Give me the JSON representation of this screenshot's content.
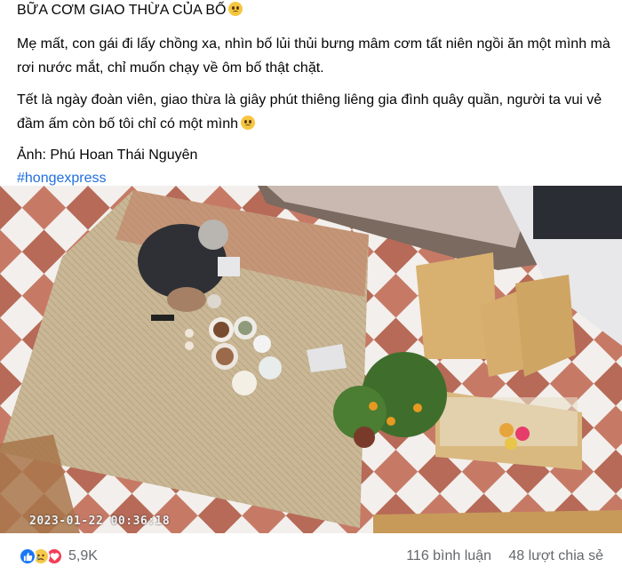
{
  "post": {
    "title": "BỮA CƠM GIAO THỪA CỦA BỐ",
    "paragraph_1": "Mẹ mất, con gái đi lấy chồng xa, nhìn bố lủi thủi bưng mâm cơm tất niên ngồi ăn một mình mà rơi nước mắt, chỉ muốn chạy về ôm bố thật chặt.",
    "paragraph_2": "Tết là ngày đoàn viên, giao thừa là giây phút thiêng liêng gia đình quây quần, người ta vui vẻ đầm ấm còn bố tôi chỉ có một mình",
    "credit": "Ảnh: Phú Hoan Thái Nguyên",
    "hashtag": "#hongexpress",
    "title_emoji": "pleading-face-icon",
    "para2_emoji": "disappointed-face-icon"
  },
  "photo": {
    "timestamp": "2023-01-22 00:36:18"
  },
  "footer": {
    "reactions": [
      "like-icon",
      "sad-icon",
      "love-icon"
    ],
    "reaction_count": "5,9K",
    "comments": "116 bình luận",
    "shares": "48 lượt chia sẻ"
  },
  "colors": {
    "link": "#216fdb",
    "meta_text": "#65676b",
    "like": "#1877f2",
    "love": "#f33e58",
    "sad": "#f7c94b"
  }
}
